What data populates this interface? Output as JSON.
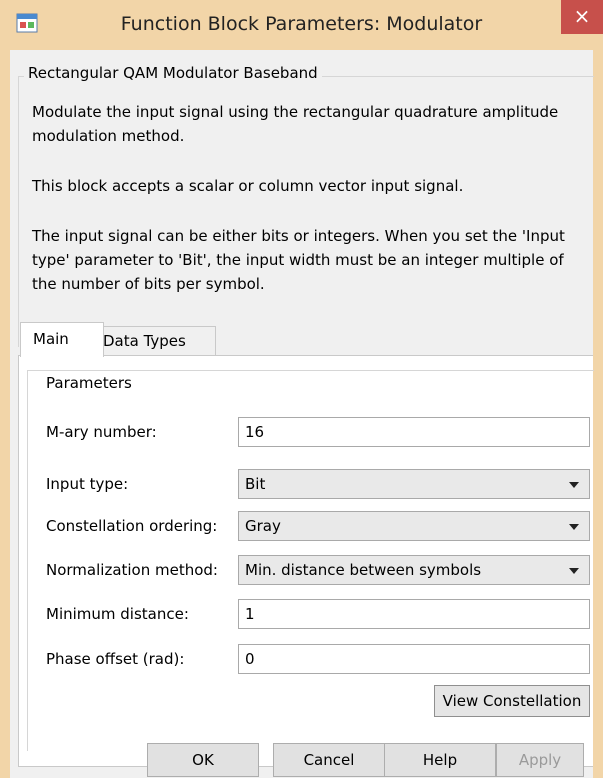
{
  "window": {
    "title": "Function Block Parameters: Modulator",
    "close_glyph": "×"
  },
  "description": {
    "group_title": "Rectangular QAM Modulator Baseband",
    "paragraphs": [
      "Modulate the input signal using the rectangular quadrature amplitude modulation method.",
      "This block accepts a scalar or column vector input signal.",
      "The input signal can be either bits or integers. When you set the 'Input type' parameter to 'Bit', the input width must be an integer multiple of the number of bits per symbol."
    ]
  },
  "tabs": [
    {
      "label": "Main",
      "active": true
    },
    {
      "label": "Data Types",
      "active": false
    }
  ],
  "parameters": {
    "group_title": "Parameters",
    "m_ary": {
      "label": "M-ary number:",
      "value": "16"
    },
    "input_type": {
      "label": "Input type:",
      "value": "Bit"
    },
    "constellation_ordering": {
      "label": "Constellation ordering:",
      "value": "Gray"
    },
    "normalization_method": {
      "label": "Normalization method:",
      "value": "Min. distance between symbols"
    },
    "minimum_distance": {
      "label": "Minimum distance:",
      "value": "1"
    },
    "phase_offset": {
      "label": "Phase offset (rad):",
      "value": "0"
    },
    "view_constellation_label": "View Constellation"
  },
  "buttons": {
    "ok": "OK",
    "cancel": "Cancel",
    "help": "Help",
    "apply": "Apply"
  },
  "colors": {
    "titlebar": "#f2d5a8",
    "close": "#c7504b"
  }
}
